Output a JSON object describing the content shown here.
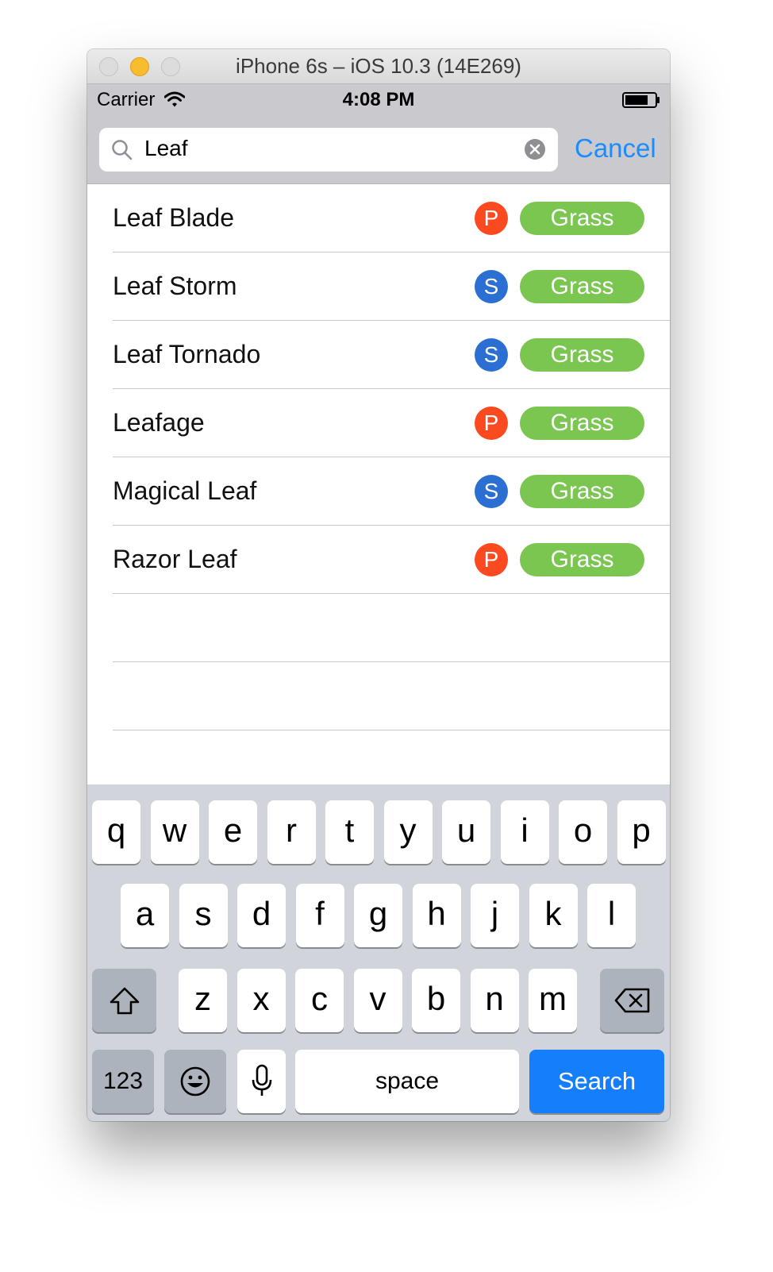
{
  "window": {
    "title": "iPhone 6s – iOS 10.3 (14E269)"
  },
  "status": {
    "carrier": "Carrier",
    "time": "4:08 PM"
  },
  "search": {
    "value": "Leaf",
    "cancel_label": "Cancel"
  },
  "colors": {
    "physical": "#fc4a20",
    "special": "#2b6fd3",
    "grass": "#7ac650",
    "accent": "#1a8cff"
  },
  "results": [
    {
      "name": "Leaf Blade",
      "category": "P",
      "type": "Grass"
    },
    {
      "name": "Leaf Storm",
      "category": "S",
      "type": "Grass"
    },
    {
      "name": "Leaf Tornado",
      "category": "S",
      "type": "Grass"
    },
    {
      "name": "Leafage",
      "category": "P",
      "type": "Grass"
    },
    {
      "name": "Magical Leaf",
      "category": "S",
      "type": "Grass"
    },
    {
      "name": "Razor Leaf",
      "category": "P",
      "type": "Grass"
    }
  ],
  "keyboard": {
    "row1": [
      "q",
      "w",
      "e",
      "r",
      "t",
      "y",
      "u",
      "i",
      "o",
      "p"
    ],
    "row2": [
      "a",
      "s",
      "d",
      "f",
      "g",
      "h",
      "j",
      "k",
      "l"
    ],
    "row3": [
      "z",
      "x",
      "c",
      "v",
      "b",
      "n",
      "m"
    ],
    "numbers_label": "123",
    "space_label": "space",
    "return_label": "Search",
    "icons": {
      "shift": "shift-icon",
      "delete": "delete-icon",
      "emoji": "emoji-icon",
      "dictation": "microphone-icon"
    }
  }
}
